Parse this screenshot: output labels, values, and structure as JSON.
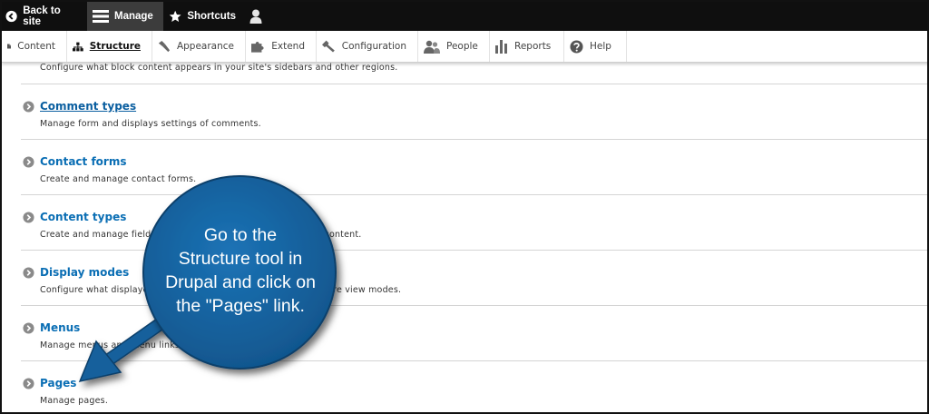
{
  "toolbar": {
    "back_label": "Back to site",
    "manage_label": "Manage",
    "shortcuts_label": "Shortcuts"
  },
  "tray": {
    "items": [
      {
        "label": "Content",
        "icon": "content-icon"
      },
      {
        "label": "Structure",
        "icon": "structure-icon",
        "active": true
      },
      {
        "label": "Appearance",
        "icon": "appearance-icon"
      },
      {
        "label": "Extend",
        "icon": "extend-icon"
      },
      {
        "label": "Configuration",
        "icon": "configuration-icon"
      },
      {
        "label": "People",
        "icon": "people-icon"
      },
      {
        "label": "Reports",
        "icon": "reports-icon"
      },
      {
        "label": "Help",
        "icon": "help-icon"
      }
    ]
  },
  "list": {
    "partial_description": "Configure what block content appears in your site's sidebars and other regions.",
    "items": [
      {
        "title": "Comment types",
        "description": "Manage form and displays settings of comments."
      },
      {
        "title": "Contact forms",
        "description": "Create and manage contact forms."
      },
      {
        "title": "Content types",
        "description": "Create and manage fields, forms, and display settings for your content."
      },
      {
        "title": "Display modes",
        "description": "Configure what displayed information and forms appear, with more view modes."
      },
      {
        "title": "Menus",
        "description": "Manage menus and menu links."
      },
      {
        "title": "Pages",
        "description": "Manage pages."
      }
    ]
  },
  "callout": {
    "line1": "Go to the",
    "line2": "Structure tool in",
    "line3": "Drupal and click on",
    "line4": "the \"Pages\" link."
  },
  "colors": {
    "toolbar_bg": "#0f0f0f",
    "link_blue": "#0a6eb4",
    "callout_blue": "#1666a6"
  }
}
